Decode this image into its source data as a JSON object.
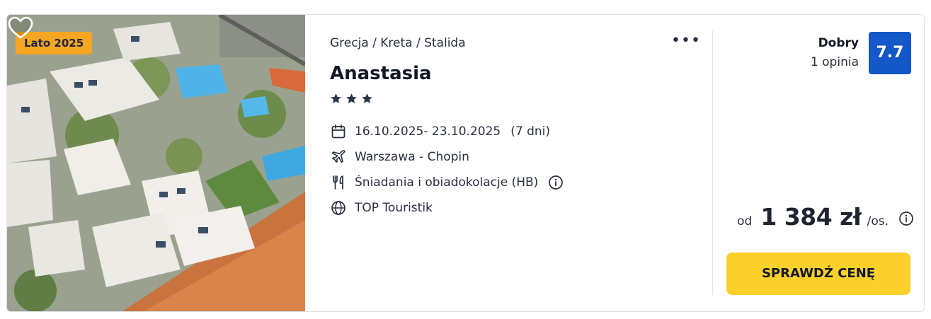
{
  "photo": {
    "badge": "Lato 2025",
    "badge_color": "#f6a623"
  },
  "favorite_icon": "heart-outline-icon",
  "breadcrumb": "Grecja / Kreta / Stalida",
  "more_icon": "more-horizontal-icon",
  "hotel": {
    "name": "Anastasia",
    "stars": 3
  },
  "trip": {
    "dates": "16.10.2025- 23.10.2025",
    "duration": "(7 dni)",
    "flight": "Warszawa - Chopin",
    "meals": "Śniadania i obiadokolacje (HB)",
    "operator": "TOP Touristik"
  },
  "rating": {
    "label": "Dobry",
    "count": "1 opinia",
    "score": "7.7",
    "score_color": "#1457c6"
  },
  "price": {
    "from": "od",
    "amount": "1 384 zł",
    "unit": "/os."
  },
  "cta": {
    "label": "SPRAWDŹ CENĘ",
    "color": "#fcd02a"
  }
}
